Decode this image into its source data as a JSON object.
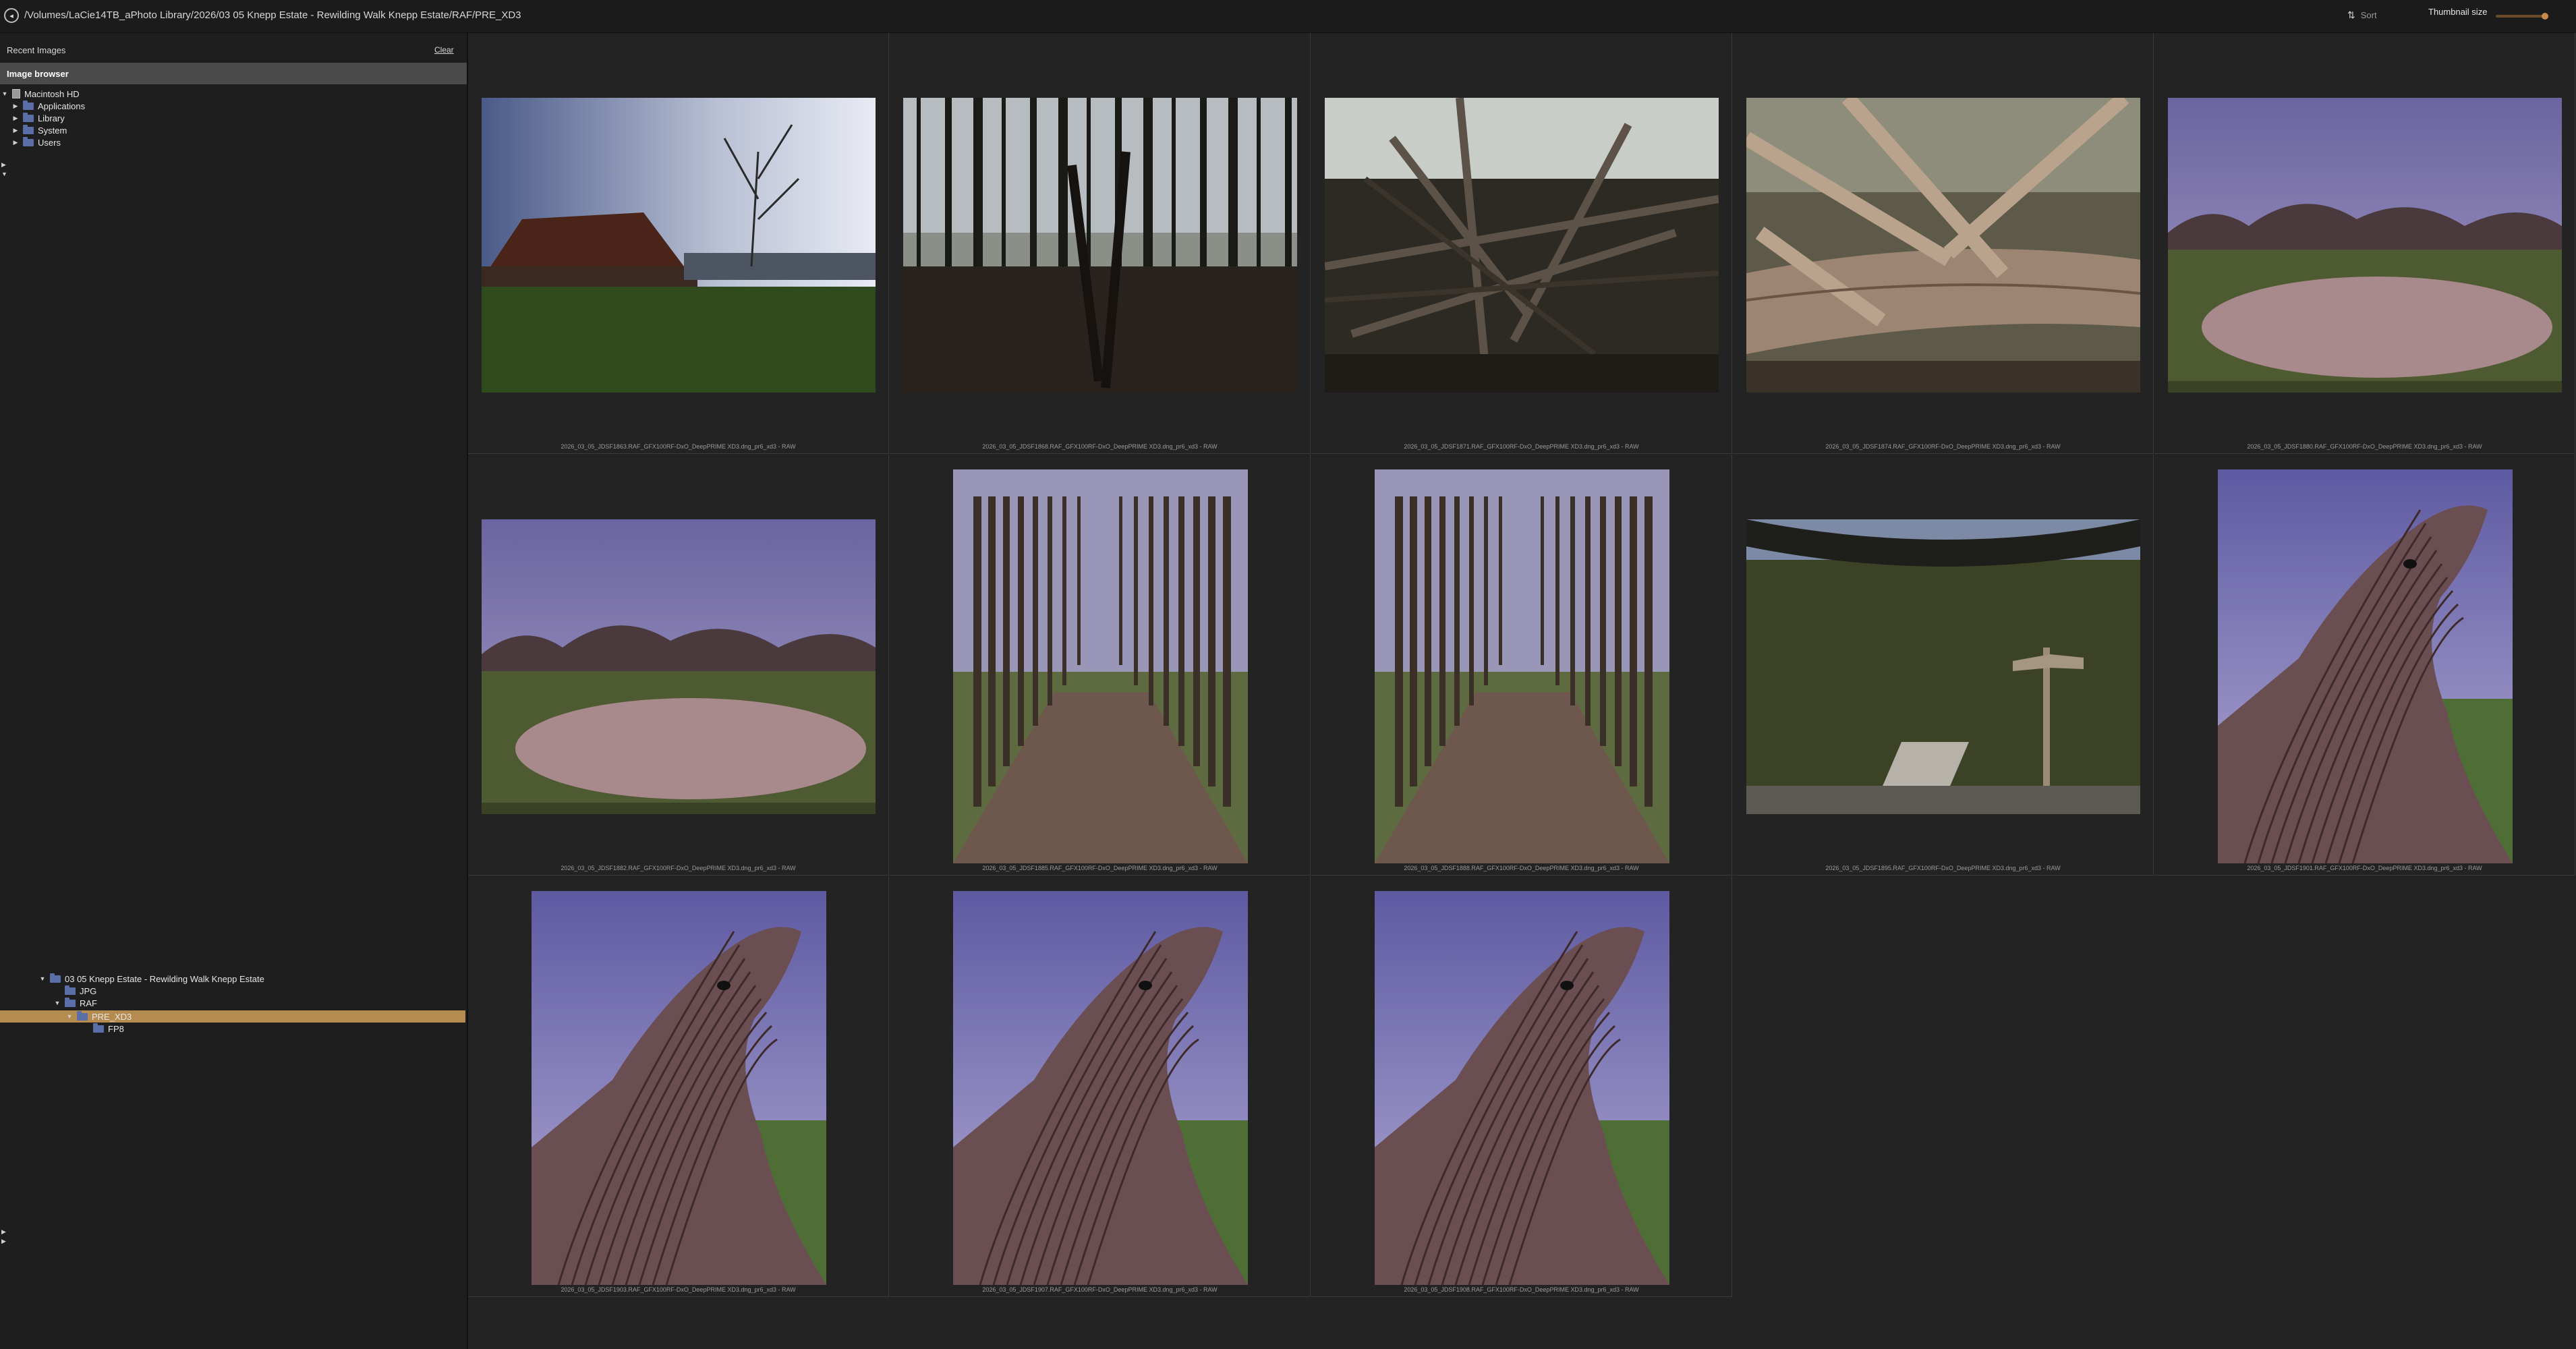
{
  "window": {
    "path": "/Volumes/LaCie14TB_aPhoto Library/2026/03 05 Knepp Estate - Rewilding Walk Knepp Estate/RAF/PRE_XD3"
  },
  "toolbar": {
    "sort_label": "Sort",
    "sort_icon": "sort-arrows-icon",
    "thumbnail_size_label": "Thumbnail size",
    "thumbnail_size_level": 0.9
  },
  "sidebar": {
    "recent_label": "Recent Images",
    "clear_label": "Clear",
    "browser_header": "Image browser",
    "tree_top": [
      {
        "label": "Macintosh HD",
        "icon": "drive-icon",
        "expanded": true
      },
      {
        "label": "Applications",
        "icon": "folder-icon"
      },
      {
        "label": "Library",
        "icon": "folder-icon"
      },
      {
        "label": "System",
        "icon": "folder-icon"
      },
      {
        "label": "Users",
        "icon": "folder-icon"
      }
    ],
    "tree_bottom": [
      {
        "label": "03 05 Knepp Estate - Rewilding Walk Knepp Estate",
        "icon": "folder-icon"
      },
      {
        "label": "JPG",
        "icon": "folder-icon"
      },
      {
        "label": "RAF",
        "icon": "folder-icon"
      },
      {
        "label": "PRE_XD3",
        "icon": "folder-icon",
        "selected": true
      },
      {
        "label": "FP8",
        "icon": "folder-icon"
      }
    ]
  },
  "grid": {
    "items": [
      {
        "caption": "2026_03_05_JDSF1863.RAF_GFX100RF-DxO_DeepPRIME XD3.dng_pr6_xd3 - RAW",
        "scene": "barn"
      },
      {
        "caption": "2026_03_05_JDSF1868.RAF_GFX100RF-DxO_DeepPRIME XD3.dng_pr6_xd3 - RAW",
        "scene": "woods-dark"
      },
      {
        "caption": "2026_03_05_JDSF1871.RAF_GFX100RF-DxO_DeepPRIME XD3.dng_pr6_xd3 - RAW",
        "scene": "fallen-branches"
      },
      {
        "caption": "2026_03_05_JDSF1874.RAF_GFX100RF-DxO_DeepPRIME XD3.dng_pr6_xd3 - RAW",
        "scene": "log"
      },
      {
        "caption": "2026_03_05_JDSF1880.RAF_GFX100RF-DxO_DeepPRIME XD3.dng_pr6_xd3 - RAW",
        "scene": "pond"
      },
      {
        "caption": "2026_03_05_JDSF1882.RAF_GFX100RF-DxO_DeepPRIME XD3.dng_pr6_xd3 - RAW",
        "scene": "pond2"
      },
      {
        "caption": "2026_03_05_JDSF1885.RAF_GFX100RF-DxO_DeepPRIME XD3.dng_pr6_xd3 - RAW",
        "scene": "avenue"
      },
      {
        "caption": "2026_03_05_JDSF1888.RAF_GFX100RF-DxO_DeepPRIME XD3.dng_pr6_xd3 - RAW",
        "scene": "avenue2"
      },
      {
        "caption": "2026_03_05_JDSF1895.RAF_GFX100RF-DxO_DeepPRIME XD3.dng_pr6_xd3 - RAW",
        "scene": "signpost"
      },
      {
        "caption": "2026_03_05_JDSF1901.RAF_GFX100RF-DxO_DeepPRIME XD3.dng_pr6_xd3 - RAW",
        "scene": "wood-stump"
      },
      {
        "caption": "2026_03_05_JDSF1903.RAF_GFX100RF-DxO_DeepPRIME XD3.dng_pr6_xd3 - RAW",
        "scene": "wood-stump"
      },
      {
        "caption": "2026_03_05_JDSF1907.RAF_GFX100RF-DxO_DeepPRIME XD3.dng_pr6_xd3 - RAW",
        "scene": "wood-stump"
      },
      {
        "caption": "2026_03_05_JDSF1908.RAF_GFX100RF-DxO_DeepPRIME XD3.dng_pr6_xd3 - RAW",
        "scene": "wood-stump"
      }
    ]
  },
  "colors": {
    "selection": "#b58b4f",
    "folder": "#5a6ea8",
    "background": "#232323"
  }
}
